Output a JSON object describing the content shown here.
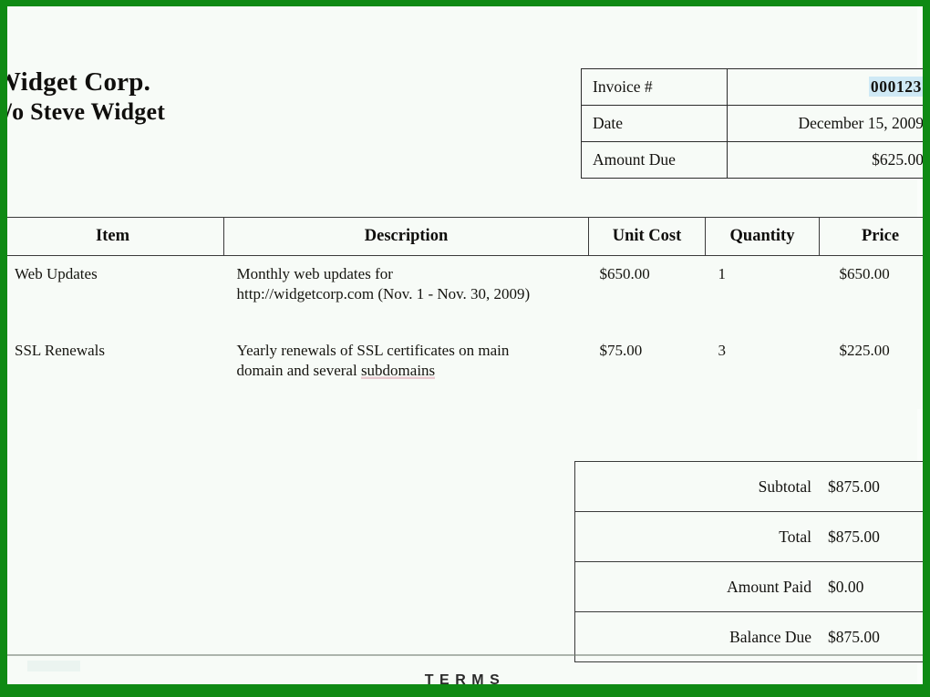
{
  "theme": {
    "border_color": "#0f8a14",
    "page_background": "#f7fbf7",
    "text_color": "#13120f",
    "rule_color": "#3a3a3a",
    "selection_highlight": "#cfe9f5",
    "spellcheck_underline": "#e8c9cf"
  },
  "company": {
    "name": "Widget Corp.",
    "contact": "c/o Steve Widget"
  },
  "invoice_meta": {
    "rows": [
      {
        "label": "Invoice #",
        "value": "000123",
        "highlighted": true
      },
      {
        "label": "Date",
        "value": "December 15, 2009",
        "highlighted": false
      },
      {
        "label": "Amount Due",
        "value": "$625.00",
        "highlighted": false
      }
    ]
  },
  "items": {
    "headers": [
      "Item",
      "Description",
      "Unit Cost",
      "Quantity",
      "Price"
    ],
    "rows": [
      {
        "item": "Web Updates",
        "description_line1": "Monthly web updates for",
        "description_line2": "http://widgetcorp.com (Nov. 1 - Nov. 30, 2009)",
        "unit_cost": "$650.00",
        "quantity": "1",
        "price": "$650.00"
      },
      {
        "item": "SSL Renewals",
        "description_line1": "Yearly renewals of SSL certificates on main",
        "description_line2_pre": "domain and several ",
        "description_line2_flagged": "subdomains",
        "unit_cost": "$75.00",
        "quantity": "3",
        "price": "$225.00"
      }
    ]
  },
  "totals": {
    "rows": [
      {
        "label": "Subtotal",
        "value": "$875.00"
      },
      {
        "label": "Total",
        "value": "$875.00"
      },
      {
        "label": "Amount Paid",
        "value": "$0.00"
      },
      {
        "label": "Balance Due",
        "value": "$875.00"
      }
    ]
  },
  "footer": {
    "terms_heading": "TERMS"
  }
}
